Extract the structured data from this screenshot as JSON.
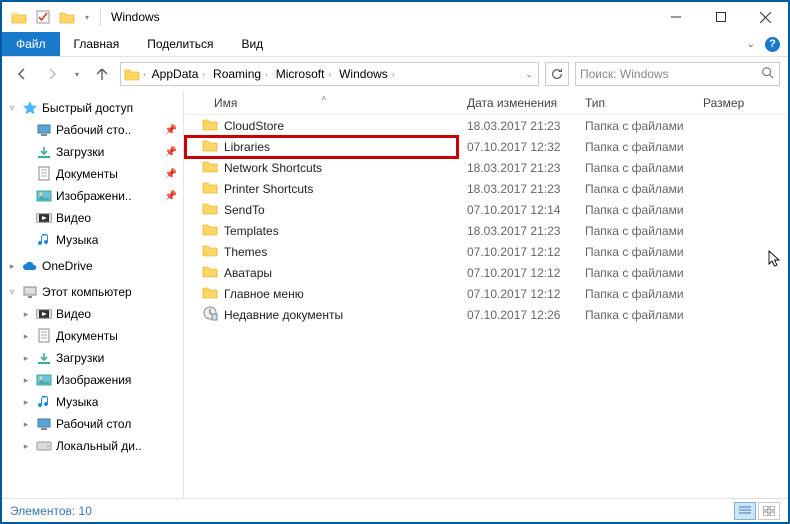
{
  "window": {
    "title": "Windows"
  },
  "ribbon": {
    "file": "Файл",
    "tabs": [
      "Главная",
      "Поделиться",
      "Вид"
    ]
  },
  "breadcrumbs": [
    "AppData",
    "Roaming",
    "Microsoft",
    "Windows"
  ],
  "search": {
    "placeholder": "Поиск: Windows"
  },
  "columns": {
    "name": "Имя",
    "date": "Дата изменения",
    "type": "Тип",
    "size": "Размер"
  },
  "sidebar": {
    "quick": {
      "label": "Быстрый доступ",
      "items": [
        {
          "label": "Рабочий сто..",
          "icon": "desktop",
          "pinned": true
        },
        {
          "label": "Загрузки",
          "icon": "downloads",
          "pinned": true
        },
        {
          "label": "Документы",
          "icon": "documents",
          "pinned": true
        },
        {
          "label": "Изображени..",
          "icon": "pictures",
          "pinned": true
        },
        {
          "label": "Видео",
          "icon": "videos",
          "pinned": false
        },
        {
          "label": "Музыка",
          "icon": "music",
          "pinned": false
        }
      ]
    },
    "onedrive": {
      "label": "OneDrive"
    },
    "thispc": {
      "label": "Этот компьютер",
      "items": [
        {
          "label": "Видео",
          "icon": "videos"
        },
        {
          "label": "Документы",
          "icon": "documents"
        },
        {
          "label": "Загрузки",
          "icon": "downloads"
        },
        {
          "label": "Изображения",
          "icon": "pictures"
        },
        {
          "label": "Музыка",
          "icon": "music"
        },
        {
          "label": "Рабочий стол",
          "icon": "desktop"
        },
        {
          "label": "Локальный ди..",
          "icon": "disk"
        }
      ]
    }
  },
  "files": [
    {
      "name": "CloudStore",
      "date": "18.03.2017 21:23",
      "type": "Папка с файлами",
      "icon": "folder"
    },
    {
      "name": "Libraries",
      "date": "07.10.2017 12:32",
      "type": "Папка с файлами",
      "icon": "folder",
      "highlight": true
    },
    {
      "name": "Network Shortcuts",
      "date": "18.03.2017 21:23",
      "type": "Папка с файлами",
      "icon": "folder"
    },
    {
      "name": "Printer Shortcuts",
      "date": "18.03.2017 21:23",
      "type": "Папка с файлами",
      "icon": "folder"
    },
    {
      "name": "SendTo",
      "date": "07.10.2017 12:14",
      "type": "Папка с файлами",
      "icon": "folder"
    },
    {
      "name": "Templates",
      "date": "18.03.2017 21:23",
      "type": "Папка с файлами",
      "icon": "folder"
    },
    {
      "name": "Themes",
      "date": "07.10.2017 12:12",
      "type": "Папка с файлами",
      "icon": "folder"
    },
    {
      "name": "Аватары",
      "date": "07.10.2017 12:12",
      "type": "Папка с файлами",
      "icon": "folder"
    },
    {
      "name": "Главное меню",
      "date": "07.10.2017 12:12",
      "type": "Папка с файлами",
      "icon": "folder"
    },
    {
      "name": "Недавние документы",
      "date": "07.10.2017 12:26",
      "type": "Папка с файлами",
      "icon": "recent"
    }
  ],
  "status": {
    "text": "Элементов: 10"
  }
}
